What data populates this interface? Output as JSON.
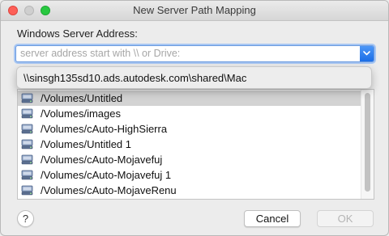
{
  "window": {
    "title": "New Server Path Mapping"
  },
  "form": {
    "server_address_label": "Windows Server Address:",
    "server_address_value": "",
    "server_address_placeholder": "server address start with \\\\ or Drive:"
  },
  "suggestion_popup": {
    "items": [
      "\\\\sinsgh135sd10.ads.autodesk.com\\shared\\Mac"
    ]
  },
  "volumes_list": {
    "selected_index": 0,
    "items": [
      {
        "path": "/Volumes/Untitled",
        "icon": "drive-icon"
      },
      {
        "path": "/Volumes/images",
        "icon": "drive-icon"
      },
      {
        "path": "/Volumes/cAuto-HighSierra",
        "icon": "drive-icon"
      },
      {
        "path": "/Volumes/Untitled 1",
        "icon": "drive-icon"
      },
      {
        "path": "/Volumes/cAuto-Mojavefuj",
        "icon": "drive-icon"
      },
      {
        "path": "/Volumes/cAuto-Mojavefuj 1",
        "icon": "drive-icon"
      },
      {
        "path": "/Volumes/cAuto-MojaveRenu",
        "icon": "drive-icon"
      }
    ]
  },
  "buttons": {
    "help_label": "?",
    "cancel_label": "Cancel",
    "ok_label": "OK",
    "ok_enabled": false
  },
  "colors": {
    "accent": "#1a6de6",
    "focus_ring": "#a8c7f3",
    "selection": "#d3d3d3",
    "close": "#fd5f57",
    "maximize": "#28c840"
  }
}
